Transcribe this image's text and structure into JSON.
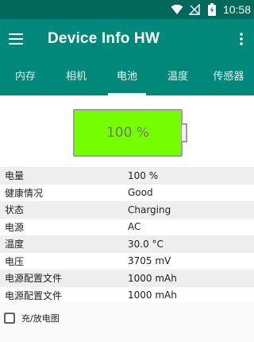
{
  "status_bar": {
    "time": "10:58",
    "icons": [
      "wifi-icon",
      "no-signal-icon",
      "battery-charging-icon"
    ]
  },
  "app_bar": {
    "title": "Device Info HW",
    "menu_icon": "hamburger-icon",
    "overflow_icon": "more-vert-icon"
  },
  "tabs": [
    {
      "label": "内存"
    },
    {
      "label": "相机"
    },
    {
      "label": "电池",
      "active": true
    },
    {
      "label": "温度"
    },
    {
      "label": "传感器"
    }
  ],
  "battery": {
    "level_text": "100 %",
    "level": 1.0,
    "fill_color": "#76ff03"
  },
  "info_rows": [
    {
      "key": "电量",
      "value": "100 %"
    },
    {
      "key": "健康情况",
      "value": "Good"
    },
    {
      "key": "状态",
      "value": "Charging"
    },
    {
      "key": "电源",
      "value": "AC"
    },
    {
      "key": "温度",
      "value": "30.0 °C"
    },
    {
      "key": "电压",
      "value": "3705 mV"
    },
    {
      "key": "电源配置文件",
      "value": "1000 mAh"
    },
    {
      "key": "电源配置文件",
      "value": "1000 mAh"
    }
  ],
  "checkbox": {
    "label": "充/放电图",
    "checked": false
  },
  "colors": {
    "primary": "#00897b",
    "primary_dark": "#00695c",
    "battery_fill": "#76ff03"
  }
}
